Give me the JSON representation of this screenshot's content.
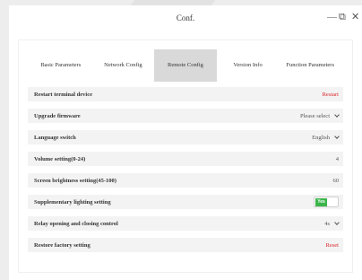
{
  "window": {
    "title": "Conf.",
    "minimize_glyph": "—",
    "restore_glyph": "⧉",
    "close_glyph": "✕"
  },
  "tabs": [
    {
      "label": "Basic Parameters",
      "active": false
    },
    {
      "label": "Network Config",
      "active": false
    },
    {
      "label": "Remote Config",
      "active": true
    },
    {
      "label": "Version Info",
      "active": false
    },
    {
      "label": "Function Parameters",
      "active": false
    }
  ],
  "settings": {
    "restart": {
      "label": "Restart terminal device",
      "value": "Restart"
    },
    "upgrade": {
      "label": "Upgrade firmware",
      "value": "Please select"
    },
    "language": {
      "label": "Language switch",
      "value": "English"
    },
    "volume": {
      "label": "Volume setting(0-24)",
      "value": "4"
    },
    "brightness": {
      "label": "Screen brightness setting(45-100)",
      "value": "60"
    },
    "lighting": {
      "label": "Supplementary lighting setting",
      "toggle_text": "Yes",
      "on": true
    },
    "relay": {
      "label": "Relay opening and closing control",
      "value": "4s"
    },
    "factory": {
      "label": "Restore factory setting",
      "value": "Reset"
    }
  },
  "colors": {
    "action_red": "#d9262c",
    "toggle_green": "#3bb54a",
    "active_tab": "#d9d9d9"
  }
}
